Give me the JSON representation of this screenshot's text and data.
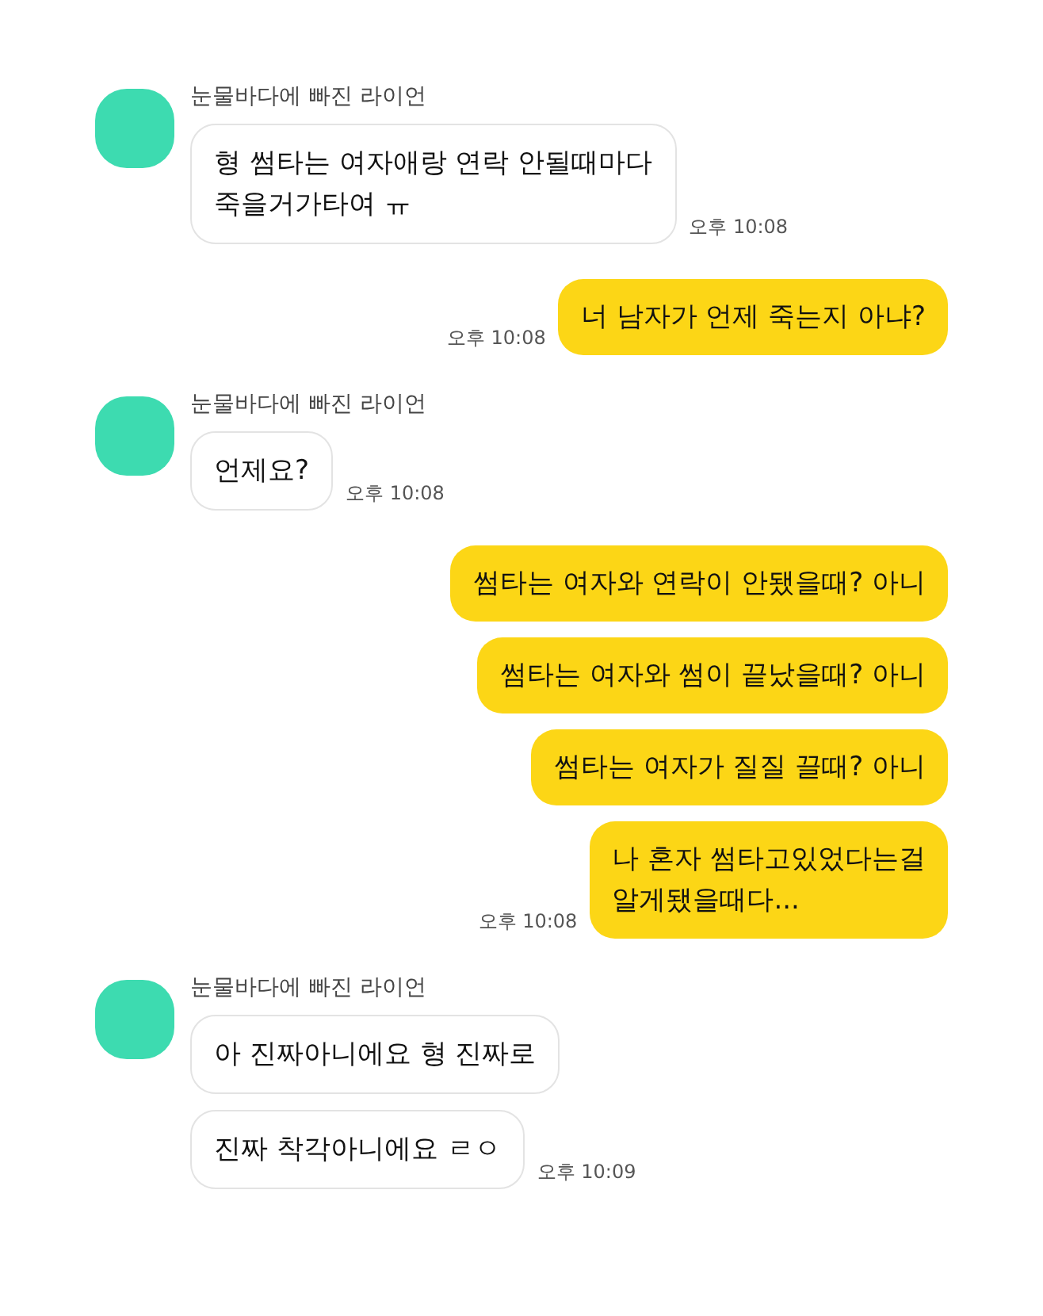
{
  "messages": [
    {
      "kind": "received",
      "sender": "눈물바다에 빠진 라이언",
      "bubbles": [
        "형 썸타는 여자애랑 연락 안될때마다\n죽을거가타여 ㅠ"
      ],
      "time": "오후 10:08"
    },
    {
      "kind": "sent",
      "bubbles": [
        "너 남자가 언제 죽는지 아냐?"
      ],
      "time": "오후 10:08"
    },
    {
      "kind": "received",
      "sender": "눈물바다에 빠진 라이언",
      "bubbles": [
        "언제요?"
      ],
      "time": "오후 10:08"
    },
    {
      "kind": "sent",
      "bubbles": [
        "썸타는 여자와 연락이 안됐을때? 아니",
        "썸타는 여자와 썸이 끝났을때? 아니",
        "썸타는 여자가 질질 끌때? 아니",
        "나 혼자 썸타고있었다는걸\n알게됐을때다..."
      ],
      "time": "오후 10:08"
    },
    {
      "kind": "received",
      "sender": "눈물바다에 빠진 라이언",
      "bubbles": [
        "아 진짜아니에요 형 진짜로",
        "진짜 착각아니에요 ㄹㅇ"
      ],
      "time": "오후 10:09"
    }
  ]
}
